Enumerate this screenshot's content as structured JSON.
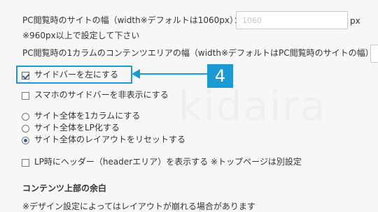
{
  "watermark": "kidaira",
  "settings": {
    "pc_width_label": "PC閲覧時のサイトの幅（width※デフォルトは1060px）：",
    "pc_width_placeholder": "1060",
    "pc_width_unit": "px",
    "pc_width_note": "※960px以上で設定して下さい",
    "one_col_label": "PC閲覧時の1カラムのコンテンツエリアの幅（width※デフォルトはPC閲覧時のサイトの幅）："
  },
  "options": {
    "sidebar_left": {
      "label": "サイドバーを左にする",
      "checked": true
    },
    "sidebar_hide_mobile": {
      "label": "スマホのサイドバーを非表示にする",
      "checked": false
    }
  },
  "layout_radios": [
    {
      "label": "サイト全体を1カラムにする",
      "checked": false
    },
    {
      "label": "サイト全体をLP化する",
      "checked": false
    },
    {
      "label": "サイト全体のレイアウトをリセットする",
      "checked": true
    }
  ],
  "lp_header": {
    "label": "LP時にヘッダー（headerエリア）を表示する ※トップページは別設定",
    "checked": false
  },
  "section_heading": "コンテンツ上部の余白",
  "section_note": "※デザイン設定によってはレイアウトが崩れる場合があります",
  "annotation": {
    "step": "4",
    "accent": "#1b9bd1"
  }
}
